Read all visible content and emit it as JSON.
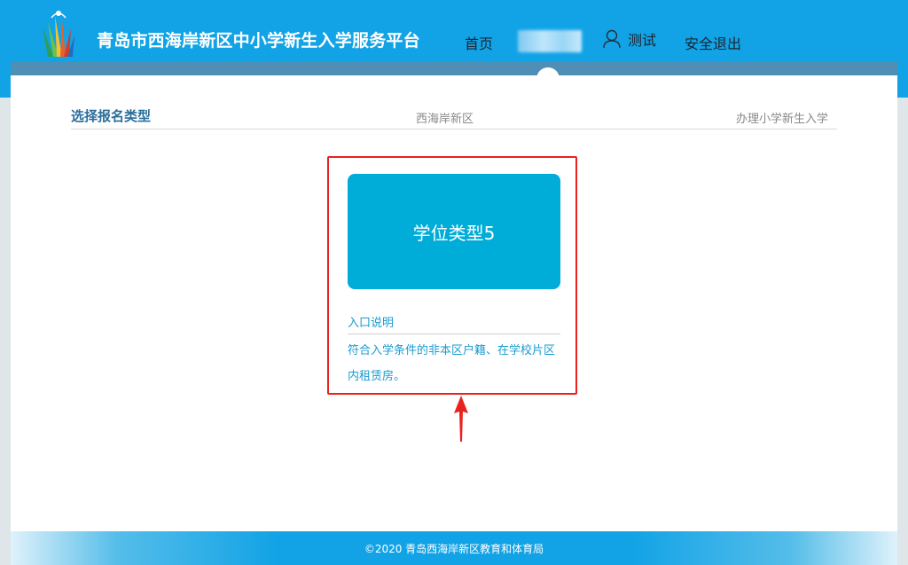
{
  "header": {
    "site_title": "青岛市西海岸新区中小学新生入学服务平台",
    "nav": {
      "home": "首页",
      "user": "测试",
      "logout": "安全退出"
    }
  },
  "section": {
    "title": "选择报名类型",
    "district": "西海岸新区",
    "service": "办理小学新生入学"
  },
  "card": {
    "label": "学位类型5",
    "desc_title": "入口说明",
    "desc_body": "符合入学条件的非本区户籍、在学校片区内租赁房。"
  },
  "footer": {
    "copyright": "©2020 青岛西海岸新区教育和体育局"
  },
  "icons": [
    "logo-icon",
    "user-icon",
    "red-arrow-annotation"
  ],
  "colors": {
    "header_bg": "#12a3e6",
    "card_bg": "#00acd8",
    "annotation_red": "#e8231d",
    "link_blue": "#1a9bd0"
  }
}
